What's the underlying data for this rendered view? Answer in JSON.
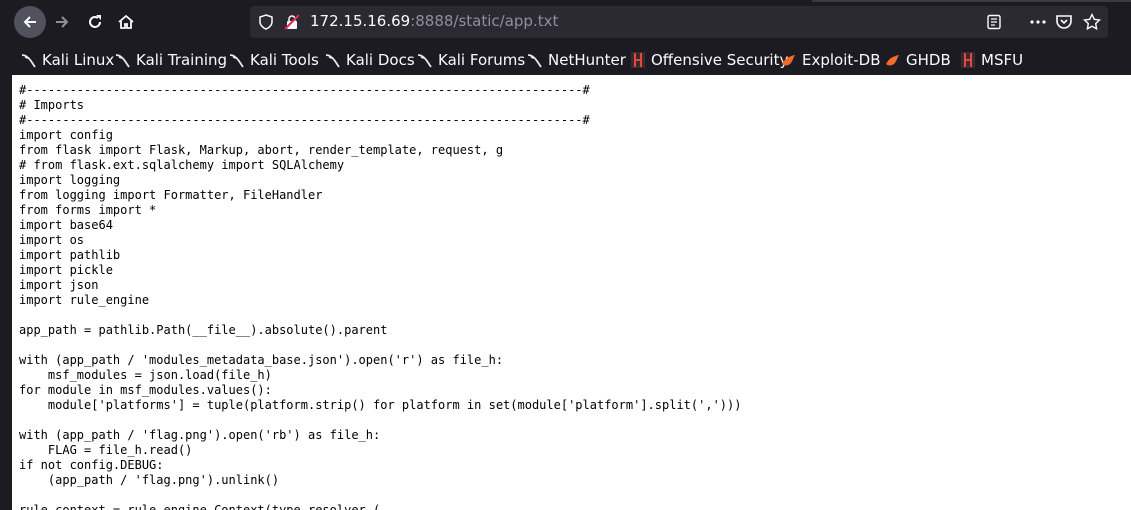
{
  "browser": {
    "url_host": "172.15.16.69",
    "url_rest": ":8888/static/app.txt"
  },
  "bookmarks": [
    {
      "label": "Kali Linux",
      "icon": "kali-dragon-icon"
    },
    {
      "label": "Kali Training",
      "icon": "kali-dragon-icon"
    },
    {
      "label": "Kali Tools",
      "icon": "kali-dragon-icon"
    },
    {
      "label": "Kali Docs",
      "icon": "kali-dragon-icon"
    },
    {
      "label": "Kali Forums",
      "icon": "kali-dragon-icon"
    },
    {
      "label": "NetHunter",
      "icon": "kali-dragon-icon"
    },
    {
      "label": "Offensive Security",
      "icon": "offsec-icon"
    },
    {
      "label": "Exploit-DB",
      "icon": "exploit-db-icon"
    },
    {
      "label": "GHDB",
      "icon": "exploit-db-icon"
    },
    {
      "label": "MSFU",
      "icon": "offsec-icon"
    }
  ],
  "document": {
    "lines": [
      "#-----------------------------------------------------------------------------#",
      "# Imports",
      "#-----------------------------------------------------------------------------#",
      "import config",
      "from flask import Flask, Markup, abort, render_template, request, g",
      "# from flask.ext.sqlalchemy import SQLAlchemy",
      "import logging",
      "from logging import Formatter, FileHandler",
      "from forms import *",
      "import base64",
      "import os",
      "import pathlib",
      "import pickle",
      "import json",
      "import rule_engine",
      "",
      "app_path = pathlib.Path(__file__).absolute().parent",
      "",
      "with (app_path / 'modules_metadata_base.json').open('r') as file_h:",
      "    msf_modules = json.load(file_h)",
      "for module in msf_modules.values():",
      "    module['platforms'] = tuple(platform.strip() for platform in set(module['platform'].split(',')))",
      "",
      "with (app_path / 'flag.png').open('rb') as file_h:",
      "    FLAG = file_h.read()",
      "if not config.DEBUG:",
      "    (app_path / 'flag.png').unlink()",
      "",
      "rule_context = rule_engine.Context(type_resolver ("
    ]
  }
}
